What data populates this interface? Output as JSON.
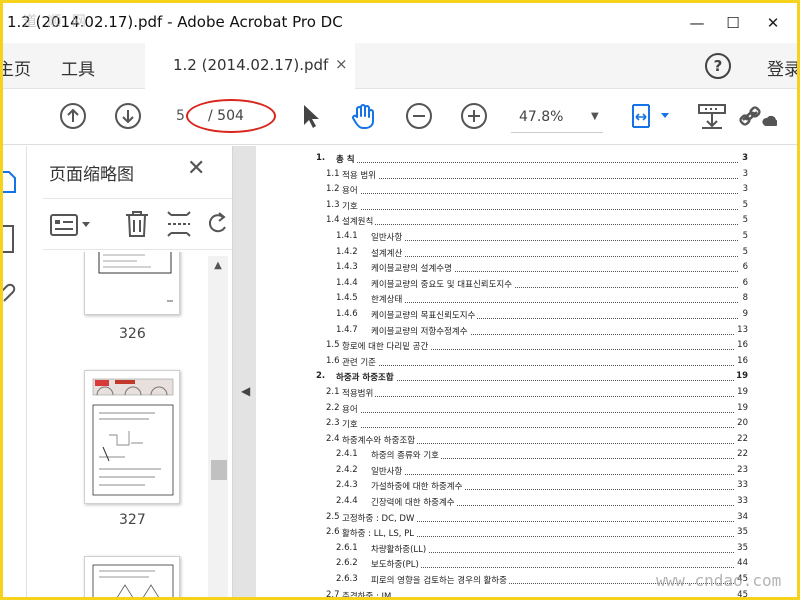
{
  "window": {
    "title": "1.2 (2014.02.17).pdf - Adobe Acrobat Pro DC",
    "watermark_top": "道 顺 网",
    "watermark_bottom": "www.cndao.com",
    "controls": {
      "minimize": "—",
      "maximize": "☐",
      "close": "✕"
    }
  },
  "tabs": {
    "home": "主页",
    "tools": "工具",
    "document": "1.2 (2014.02.17).pdf",
    "document_close": "×",
    "login": "登录"
  },
  "toolbar": {
    "page_current": "5",
    "page_total": "/ 504",
    "zoom": "47.8%",
    "icons": [
      "arrow-up-icon",
      "arrow-down-icon",
      "select-pointer-icon",
      "hand-icon",
      "zoom-out-icon",
      "zoom-in-icon",
      "fit-page-icon",
      "save-icon",
      "link-icon"
    ]
  },
  "panel": {
    "title": "页面缩略图",
    "close": "✕",
    "thumbnails": [
      {
        "page": "326"
      },
      {
        "page": "327"
      }
    ]
  },
  "toc": [
    {
      "level": 1,
      "num": "1.",
      "title": "총 칙",
      "page": "3"
    },
    {
      "level": 2,
      "num": "1.1",
      "title": "적용 범위",
      "page": "3"
    },
    {
      "level": 2,
      "num": "1.2",
      "title": "용어",
      "page": "3"
    },
    {
      "level": 2,
      "num": "1.3",
      "title": "기호",
      "page": "5"
    },
    {
      "level": 2,
      "num": "1.4",
      "title": "설계원칙",
      "page": "5"
    },
    {
      "level": 3,
      "num": "1.4.1",
      "title": "일반사항",
      "page": "5"
    },
    {
      "level": 3,
      "num": "1.4.2",
      "title": "설계계산",
      "page": "5"
    },
    {
      "level": 3,
      "num": "1.4.3",
      "title": "케이블교량의 설계수명",
      "page": "6"
    },
    {
      "level": 3,
      "num": "1.4.4",
      "title": "케이블교량의 중요도 및 대표신뢰도지수",
      "page": "6"
    },
    {
      "level": 3,
      "num": "1.4.5",
      "title": "한계상태",
      "page": "8"
    },
    {
      "level": 3,
      "num": "1.4.6",
      "title": "케이블교량의 목표신뢰도지수",
      "page": "9"
    },
    {
      "level": 3,
      "num": "1.4.7",
      "title": "케이블교량의 저항수정계수",
      "page": "13"
    },
    {
      "level": 2,
      "num": "1.5",
      "title": "항로에 대한 다리밑 공간",
      "page": "16"
    },
    {
      "level": 2,
      "num": "1.6",
      "title": "관련 기준",
      "page": "16"
    },
    {
      "level": 1,
      "num": "2.",
      "title": "하중과 하중조합",
      "page": "19"
    },
    {
      "level": 2,
      "num": "2.1",
      "title": "적용범위",
      "page": "19"
    },
    {
      "level": 2,
      "num": "2.2",
      "title": "용어",
      "page": "19"
    },
    {
      "level": 2,
      "num": "2.3",
      "title": "기호",
      "page": "20"
    },
    {
      "level": 2,
      "num": "2.4",
      "title": "하중계수와 하중조합",
      "page": "22"
    },
    {
      "level": 3,
      "num": "2.4.1",
      "title": "하중의 종류와 기호",
      "page": "22"
    },
    {
      "level": 3,
      "num": "2.4.2",
      "title": "일반사항",
      "page": "23"
    },
    {
      "level": 3,
      "num": "2.4.3",
      "title": "가설하중에 대한 하중계수",
      "page": "33"
    },
    {
      "level": 3,
      "num": "2.4.4",
      "title": "긴장력에 대한 하중계수",
      "page": "33"
    },
    {
      "level": 2,
      "num": "2.5",
      "title": "고정하중 : DC, DW",
      "page": "34"
    },
    {
      "level": 2,
      "num": "2.6",
      "title": "활하중 : LL, LS, PL",
      "page": "35"
    },
    {
      "level": 3,
      "num": "2.6.1",
      "title": "차량활하중(LL)",
      "page": "35"
    },
    {
      "level": 3,
      "num": "2.6.2",
      "title": "보도하중(PL)",
      "page": "44"
    },
    {
      "level": 3,
      "num": "2.6.3",
      "title": "피로의 영향을 검토하는 경우의 활하중",
      "page": "45"
    },
    {
      "level": 2,
      "num": "2.7",
      "title": "충격하중 : IM",
      "page": "45"
    }
  ],
  "colors": {
    "frame": "#f6d21a",
    "highlight_ellipse": "#d9251c",
    "acrobat_blue": "#1473e6"
  }
}
